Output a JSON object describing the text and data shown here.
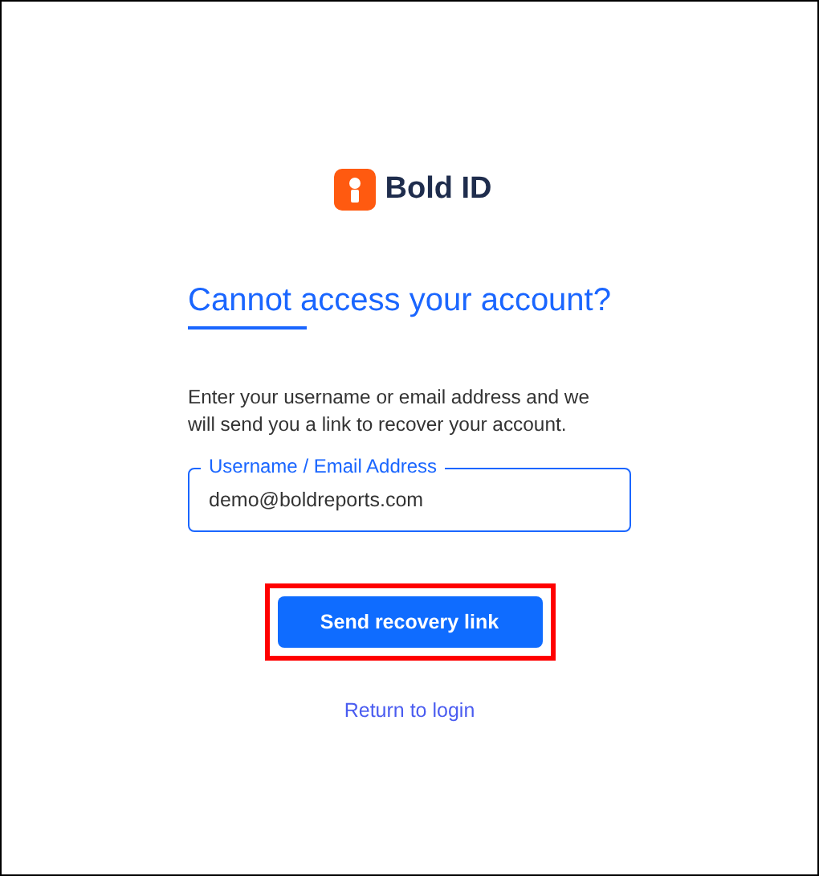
{
  "logo": {
    "text": "Bold ID"
  },
  "heading": "Cannot access your account?",
  "instructions": "Enter your username or email address and we will send you a link to recover your account.",
  "field": {
    "label": "Username / Email Address",
    "value": "demo@boldreports.com",
    "focused": true
  },
  "button": {
    "label": "Send recovery link",
    "highlighted": true
  },
  "link": "Return to login"
}
